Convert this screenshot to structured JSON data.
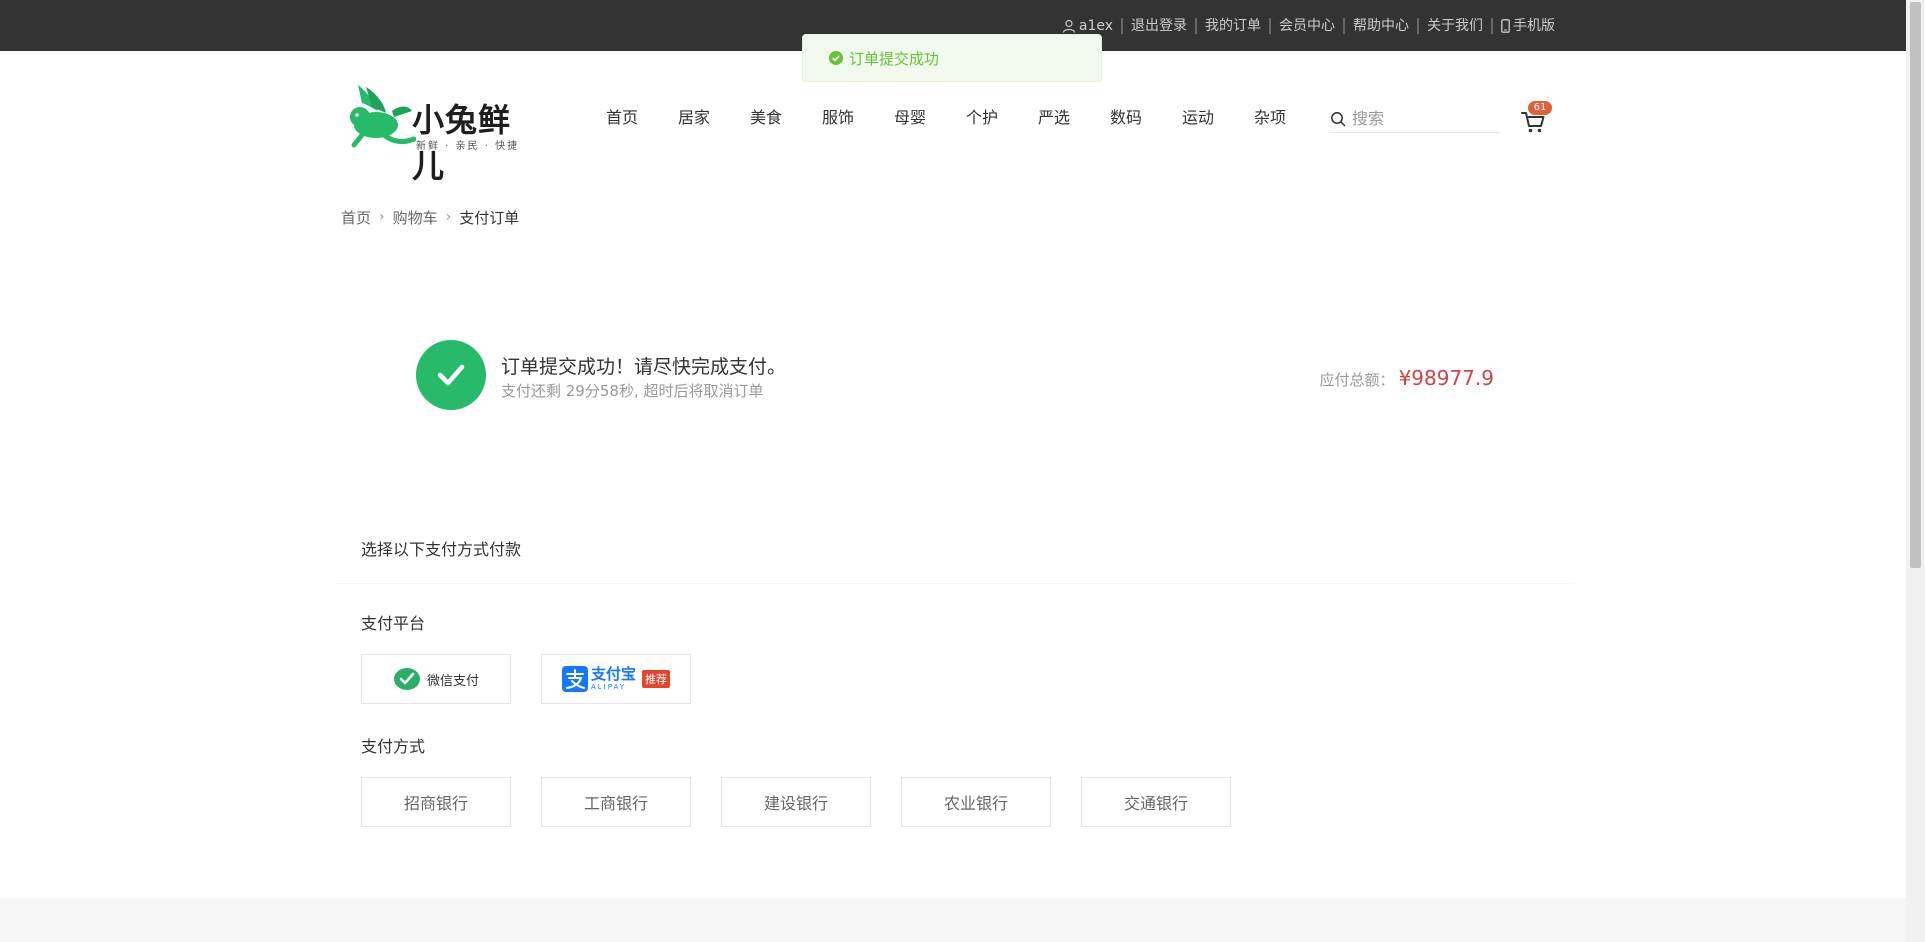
{
  "topnav": {
    "username": "a1ex",
    "logout": "退出登录",
    "my_orders": "我的订单",
    "member_center": "会员中心",
    "help_center": "帮助中心",
    "about_us": "关于我们",
    "mobile": "手机版"
  },
  "toast": {
    "message": "订单提交成功"
  },
  "logo": {
    "brand": "小兔鲜儿",
    "slogan": "新鲜 · 亲民 · 快捷"
  },
  "mainnav": [
    "首页",
    "居家",
    "美食",
    "服饰",
    "母婴",
    "个护",
    "严选",
    "数码",
    "运动",
    "杂项"
  ],
  "search": {
    "placeholder": "搜索"
  },
  "cart": {
    "count": "61"
  },
  "breadcrumb": {
    "home": "首页",
    "cart": "购物车",
    "current": "支付订单"
  },
  "payinfo": {
    "title": "订单提交成功！请尽快完成支付。",
    "countdown": "支付还剩 29分58秒, 超时后将取消订单",
    "total_label": "应付总额：",
    "total_amount": "¥98977.9"
  },
  "methods": {
    "title": "选择以下支付方式付款",
    "platform_label": "支付平台",
    "wechat": "微信支付",
    "alipay_zh": "支付宝",
    "alipay_en": "ALIPAY",
    "recommend": "推荐",
    "bank_label": "支付方式",
    "banks": [
      "招商银行",
      "工商银行",
      "建设银行",
      "农业银行",
      "交通银行"
    ]
  },
  "colors": {
    "topbar": "#333333",
    "success": "#27ba6b",
    "price": "#cf4444",
    "badge": "#e26237",
    "toast_text": "#67c23a"
  }
}
